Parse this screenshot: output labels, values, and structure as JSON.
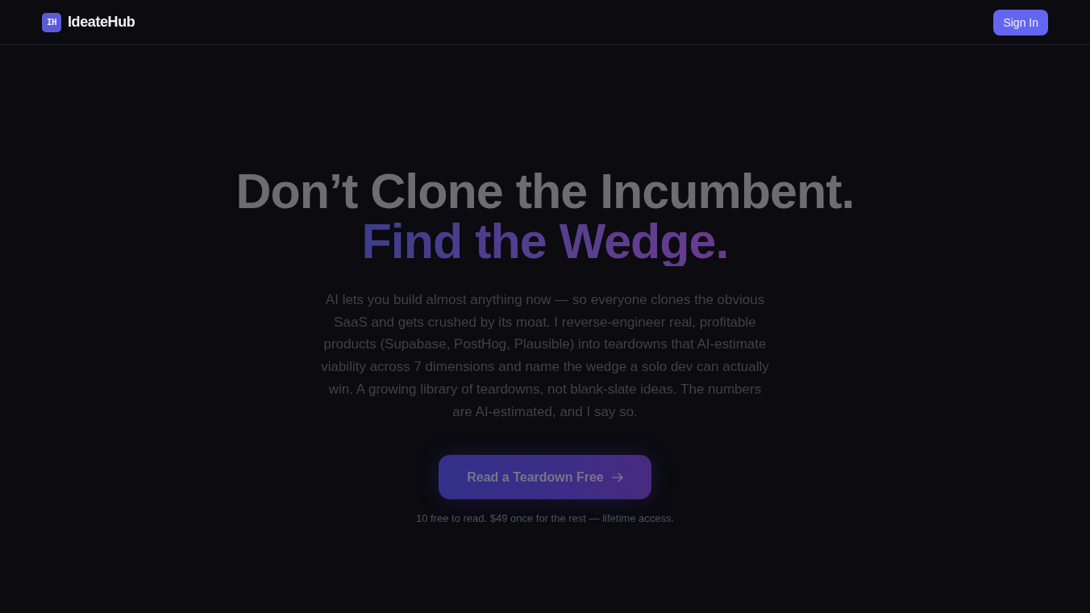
{
  "header": {
    "logo": {
      "mark": "IH",
      "name": "IdeateHub"
    },
    "sign_in_button": "Sign In"
  },
  "hero": {
    "headline": "Don’t Clone the Incumbent.",
    "headline_accent": "Find the Wedge.",
    "description": "AI lets you build almost anything now — so everyone clones the obvious SaaS and gets crushed by its moat. I reverse-engineer real, profitable products (Supabase, PostHog, Plausible) into teardowns that AI-estimate viability across 7 dimensions and name the wedge a solo dev can actually win. A growing library of teardowns, not blank-slate ideas. The numbers are AI-estimated, and I say so.",
    "cta_button": "Read a Teardown Free",
    "note": "10 free to read. $49 once for the rest — lifetime access."
  }
}
